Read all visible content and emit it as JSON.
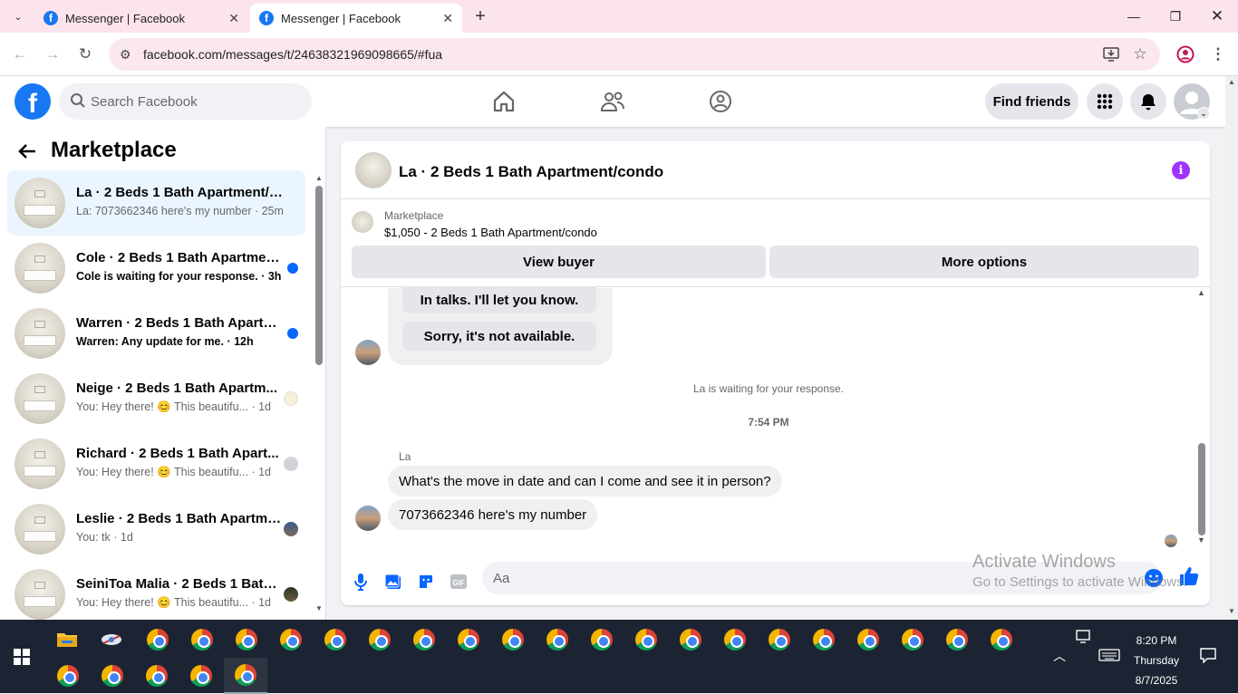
{
  "browser": {
    "tabs": [
      {
        "title": "Messenger | Facebook",
        "active": false
      },
      {
        "title": "Messenger | Facebook",
        "active": true
      }
    ],
    "url": "facebook.com/messages/t/24638321969098665/#fua"
  },
  "fb_header": {
    "search_placeholder": "Search Facebook",
    "find_friends_label": "Find friends"
  },
  "sidebar": {
    "title": "Marketplace",
    "conversations": [
      {
        "name": "La · 2 Beds 1 Bath Apartment/co...",
        "snippet": "La: 7073662346 here's my number · 25m",
        "unread": false,
        "selected": true
      },
      {
        "name": "Cole · 2 Beds 1 Bath Apartmen...",
        "snippet": "Cole is waiting for your response. · 3h",
        "unread": true
      },
      {
        "name": "Warren · 2 Beds 1 Bath Apartm...",
        "snippet": "Warren: Any update for me. · 12h",
        "unread": true
      },
      {
        "name": "Neige · 2 Beds 1 Bath Apartm...",
        "snippet": "You: Hey there! 😊 This beautifu... · 1d",
        "unread": false
      },
      {
        "name": "Richard · 2 Beds 1 Bath Apart...",
        "snippet": "You: Hey there! 😊 This beautifu... · 1d",
        "unread": false
      },
      {
        "name": "Leslie · 2 Beds 1 Bath Apartme...",
        "snippet": "You: tk · 1d",
        "unread": false
      },
      {
        "name": "SeiniToa Malia · 2 Beds 1 Bath ...",
        "snippet": "You: Hey there! 😊 This beautifu... · 1d",
        "unread": false
      }
    ]
  },
  "chat": {
    "title": "La · 2 Beds 1 Bath Apartment/condo",
    "listing_label": "Marketplace",
    "listing_price": "$1,050 - 2 Beds 1 Bath Apartment/condo",
    "view_buyer_label": "View buyer",
    "more_options_label": "More options",
    "quick_replies": [
      "In talks. I'll let you know.",
      "Sorry, it's not available."
    ],
    "waiting_text": "La is waiting for your response.",
    "timestamp": "7:54 PM",
    "sender_name": "La",
    "messages": [
      "What's the move in date and can I come and see it in person?",
      "7073662346 here's my number"
    ],
    "input_placeholder": "Aa"
  },
  "watermark": {
    "line1": "Activate Windows",
    "line2": "Go to Settings to activate Windows."
  },
  "taskbar": {
    "time": "8:20 PM",
    "day": "Thursday",
    "date": "8/7/2025"
  }
}
